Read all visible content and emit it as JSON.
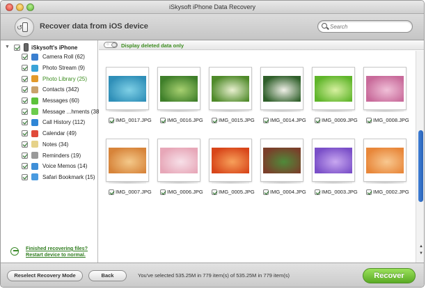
{
  "window": {
    "title": "iSkysoft iPhone Data Recovery"
  },
  "toolbar": {
    "title": "Recover data from iOS device",
    "device_icon": "phone-restore-icon"
  },
  "search": {
    "placeholder": "Search",
    "icon": "search-icon"
  },
  "sidebar": {
    "root": {
      "label": "iSkysoft's iPhone",
      "checked": true,
      "expanded": true
    },
    "items": [
      {
        "label": "Camera Roll (62)",
        "icon": "camera-icon",
        "color": "#3a7fd0",
        "checked": true,
        "selected": false
      },
      {
        "label": "Photo Stream (9)",
        "icon": "photo-stream-icon",
        "color": "#3aa3d8",
        "checked": true,
        "selected": false
      },
      {
        "label": "Photo Library (25)",
        "icon": "photo-library-icon",
        "color": "#e39a2b",
        "checked": true,
        "selected": true
      },
      {
        "label": "Contacts (342)",
        "icon": "contacts-icon",
        "color": "#c9a26b",
        "checked": true,
        "selected": false
      },
      {
        "label": "Messages (60)",
        "icon": "messages-icon",
        "color": "#5cc23a",
        "checked": true,
        "selected": false
      },
      {
        "label": "Message ...hments (38)",
        "icon": "message-attachments-icon",
        "color": "#6ccc4e",
        "checked": true,
        "selected": false
      },
      {
        "label": "Call History (112)",
        "icon": "call-history-icon",
        "color": "#2f86d6",
        "checked": true,
        "selected": false
      },
      {
        "label": "Calendar (49)",
        "icon": "calendar-icon",
        "color": "#e04a3a",
        "checked": true,
        "selected": false
      },
      {
        "label": "Notes (34)",
        "icon": "notes-icon",
        "color": "#e6d28a",
        "checked": true,
        "selected": false
      },
      {
        "label": "Reminders (19)",
        "icon": "reminders-icon",
        "color": "#9a9a9a",
        "checked": true,
        "selected": false
      },
      {
        "label": "Voice Memos (14)",
        "icon": "voice-memos-icon",
        "color": "#3f8fd8",
        "checked": true,
        "selected": false
      },
      {
        "label": "Safari Bookmark (15)",
        "icon": "safari-bookmark-icon",
        "color": "#4a9be0",
        "checked": true,
        "selected": false
      }
    ],
    "finished_link": "Finished recovering files? Restart device to normal."
  },
  "filter": {
    "label": "Display deleted data only",
    "toggle_on": false
  },
  "photos": [
    {
      "name": "IMG_0017.JPG",
      "checked": true,
      "colors": [
        "#2f8fb8",
        "#7fd0e6"
      ]
    },
    {
      "name": "IMG_0016.JPG",
      "checked": true,
      "colors": [
        "#3f7f2a",
        "#a7d070"
      ]
    },
    {
      "name": "IMG_0015.JPG",
      "checked": true,
      "colors": [
        "#4f8a2a",
        "#e9f0d0"
      ]
    },
    {
      "name": "IMG_0014.JPG",
      "checked": true,
      "colors": [
        "#2f5f2a",
        "#f0f0e8"
      ]
    },
    {
      "name": "IMG_0009.JPG",
      "checked": true,
      "colors": [
        "#5fb52a",
        "#d7f0a0"
      ]
    },
    {
      "name": "IMG_0008.JPG",
      "checked": true,
      "colors": [
        "#c86a9a",
        "#f0c0d8"
      ]
    },
    {
      "name": "IMG_0007.JPG",
      "checked": true,
      "colors": [
        "#d7843a",
        "#f4c98a"
      ]
    },
    {
      "name": "IMG_0006.JPG",
      "checked": true,
      "colors": [
        "#e7a7b8",
        "#f7e0e8"
      ]
    },
    {
      "name": "IMG_0005.JPG",
      "checked": true,
      "colors": [
        "#d8461a",
        "#f7a05a"
      ]
    },
    {
      "name": "IMG_0004.JPG",
      "checked": true,
      "colors": [
        "#7a3f2a",
        "#4f8a3a"
      ]
    },
    {
      "name": "IMG_0003.JPG",
      "checked": true,
      "colors": [
        "#7a4fc8",
        "#c8a7f0"
      ]
    },
    {
      "name": "IMG_0002.JPG",
      "checked": true,
      "colors": [
        "#e8873a",
        "#f8c890"
      ]
    }
  ],
  "bottombar": {
    "reselect_label": "Reselect Recovery Mode",
    "back_label": "Back",
    "status": "You've selected 535.25M in 779 item(s) of 535.25M in 779 item(s)",
    "recover_label": "Recover",
    "accent": "#5aaa25"
  }
}
